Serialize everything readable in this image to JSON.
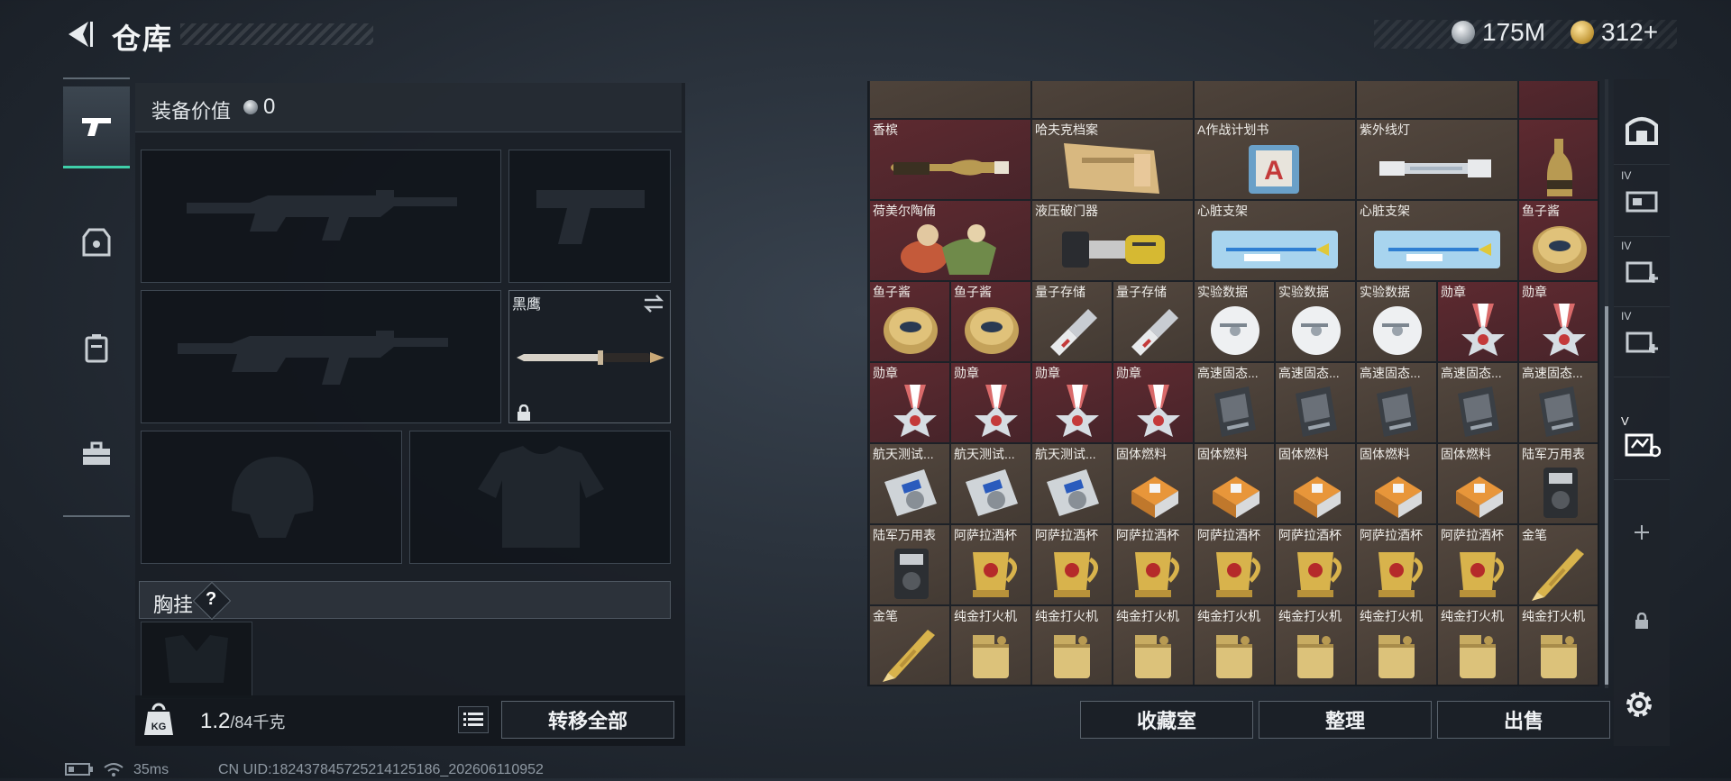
{
  "topbar": {
    "title": "仓库",
    "currency_silver": "175M",
    "currency_gold": "312+"
  },
  "equipment": {
    "value_label": "装备价值",
    "value": "0",
    "knife_name": "黑鹰",
    "chest_label": "胸挂",
    "help": "?",
    "weight": "1.2",
    "weight_max": "/84千克",
    "transfer_all": "转移全部"
  },
  "warehouse": {
    "rows": [
      [
        {
          "name": "香槟",
          "icon": "champagne",
          "span": 2,
          "bg": "red"
        },
        {
          "name": "哈夫克档案",
          "icon": "file",
          "span": 2,
          "bg": "brown"
        },
        {
          "name": "A作战计划书",
          "icon": "plan",
          "span": 2,
          "bg": "brown"
        },
        {
          "name": "紫外线灯",
          "icon": "uvlamp",
          "span": 2,
          "bg": "brown"
        },
        {
          "name": "",
          "icon": "champagne-up",
          "span": 1,
          "bg": "red"
        }
      ],
      [
        {
          "name": "荷美尔陶俑",
          "icon": "figurine",
          "span": 2,
          "bg": "red"
        },
        {
          "name": "液压破门器",
          "icon": "breacher",
          "span": 2,
          "bg": "brown"
        },
        {
          "name": "心脏支架",
          "icon": "stent",
          "span": 2,
          "bg": "brown"
        },
        {
          "name": "心脏支架",
          "icon": "stent",
          "span": 2,
          "bg": "brown"
        },
        {
          "name": "鱼子酱",
          "icon": "caviar",
          "span": 1,
          "bg": "red"
        }
      ],
      [
        {
          "name": "鱼子酱",
          "icon": "caviar",
          "span": 1,
          "bg": "red"
        },
        {
          "name": "鱼子酱",
          "icon": "caviar",
          "span": 1,
          "bg": "red"
        },
        {
          "name": "量子存储",
          "icon": "usb",
          "span": 1,
          "bg": "brown"
        },
        {
          "name": "量子存储",
          "icon": "usb",
          "span": 1,
          "bg": "brown"
        },
        {
          "name": "实验数据",
          "icon": "disc",
          "span": 1,
          "bg": "brown"
        },
        {
          "name": "实验数据",
          "icon": "disc",
          "span": 1,
          "bg": "brown"
        },
        {
          "name": "实验数据",
          "icon": "disc",
          "span": 1,
          "bg": "brown"
        },
        {
          "name": "勋章",
          "icon": "medal",
          "span": 1,
          "bg": "red"
        },
        {
          "name": "勋章",
          "icon": "medal",
          "span": 1,
          "bg": "red"
        }
      ],
      [
        {
          "name": "勋章",
          "icon": "medal",
          "span": 1,
          "bg": "red"
        },
        {
          "name": "勋章",
          "icon": "medal",
          "span": 1,
          "bg": "red"
        },
        {
          "name": "勋章",
          "icon": "medal",
          "span": 1,
          "bg": "red"
        },
        {
          "name": "勋章",
          "icon": "medal",
          "span": 1,
          "bg": "red"
        },
        {
          "name": "高速固态...",
          "icon": "ssd",
          "span": 1,
          "bg": "brown"
        },
        {
          "name": "高速固态...",
          "icon": "ssd",
          "span": 1,
          "bg": "brown"
        },
        {
          "name": "高速固态...",
          "icon": "ssd",
          "span": 1,
          "bg": "brown"
        },
        {
          "name": "高速固态...",
          "icon": "ssd",
          "span": 1,
          "bg": "brown"
        },
        {
          "name": "高速固态...",
          "icon": "ssd",
          "span": 1,
          "bg": "brown"
        }
      ],
      [
        {
          "name": "航天测试...",
          "icon": "tester",
          "span": 1,
          "bg": "brown"
        },
        {
          "name": "航天测试...",
          "icon": "tester",
          "span": 1,
          "bg": "brown"
        },
        {
          "name": "航天测试...",
          "icon": "tester",
          "span": 1,
          "bg": "brown"
        },
        {
          "name": "固体燃料",
          "icon": "fuel",
          "span": 1,
          "bg": "brown"
        },
        {
          "name": "固体燃料",
          "icon": "fuel",
          "span": 1,
          "bg": "brown"
        },
        {
          "name": "固体燃料",
          "icon": "fuel",
          "span": 1,
          "bg": "brown"
        },
        {
          "name": "固体燃料",
          "icon": "fuel",
          "span": 1,
          "bg": "brown"
        },
        {
          "name": "固体燃料",
          "icon": "fuel",
          "span": 1,
          "bg": "brown"
        },
        {
          "name": "陆军万用表",
          "icon": "multimeter",
          "span": 1,
          "bg": "brown"
        }
      ],
      [
        {
          "name": "陆军万用表",
          "icon": "multimeter",
          "span": 1,
          "bg": "brown"
        },
        {
          "name": "阿萨拉酒杯",
          "icon": "cup",
          "span": 1,
          "bg": "brown"
        },
        {
          "name": "阿萨拉酒杯",
          "icon": "cup",
          "span": 1,
          "bg": "brown"
        },
        {
          "name": "阿萨拉酒杯",
          "icon": "cup",
          "span": 1,
          "bg": "brown"
        },
        {
          "name": "阿萨拉酒杯",
          "icon": "cup",
          "span": 1,
          "bg": "brown"
        },
        {
          "name": "阿萨拉酒杯",
          "icon": "cup",
          "span": 1,
          "bg": "brown"
        },
        {
          "name": "阿萨拉酒杯",
          "icon": "cup",
          "span": 1,
          "bg": "brown"
        },
        {
          "name": "阿萨拉酒杯",
          "icon": "cup",
          "span": 1,
          "bg": "brown"
        },
        {
          "name": "金笔",
          "icon": "pen",
          "span": 1,
          "bg": "brown"
        }
      ],
      [
        {
          "name": "金笔",
          "icon": "pen",
          "span": 1,
          "bg": "brown"
        },
        {
          "name": "纯金打火机",
          "icon": "lighter",
          "span": 1,
          "bg": "brown"
        },
        {
          "name": "纯金打火机",
          "icon": "lighter",
          "span": 1,
          "bg": "brown"
        },
        {
          "name": "纯金打火机",
          "icon": "lighter",
          "span": 1,
          "bg": "brown"
        },
        {
          "name": "纯金打火机",
          "icon": "lighter",
          "span": 1,
          "bg": "brown"
        },
        {
          "name": "纯金打火机",
          "icon": "lighter",
          "span": 1,
          "bg": "brown"
        },
        {
          "name": "纯金打火机",
          "icon": "lighter",
          "span": 1,
          "bg": "brown"
        },
        {
          "name": "纯金打火机",
          "icon": "lighter",
          "span": 1,
          "bg": "brown"
        },
        {
          "name": "纯金打火机",
          "icon": "lighter",
          "span": 1,
          "bg": "brown"
        }
      ]
    ]
  },
  "bottom_buttons": {
    "collection": "收藏室",
    "sort": "整理",
    "sell": "出售"
  },
  "right_rail": {
    "tab_level": "IV",
    "tab_level_selected": "V"
  },
  "status": {
    "ping": "35ms",
    "uid": "CN UID:18243784572521412518​6_202606110952"
  },
  "colors": {
    "accent": "#3fcfa9",
    "rare_red": "#5e2a30",
    "item_brown": "#53473e"
  }
}
